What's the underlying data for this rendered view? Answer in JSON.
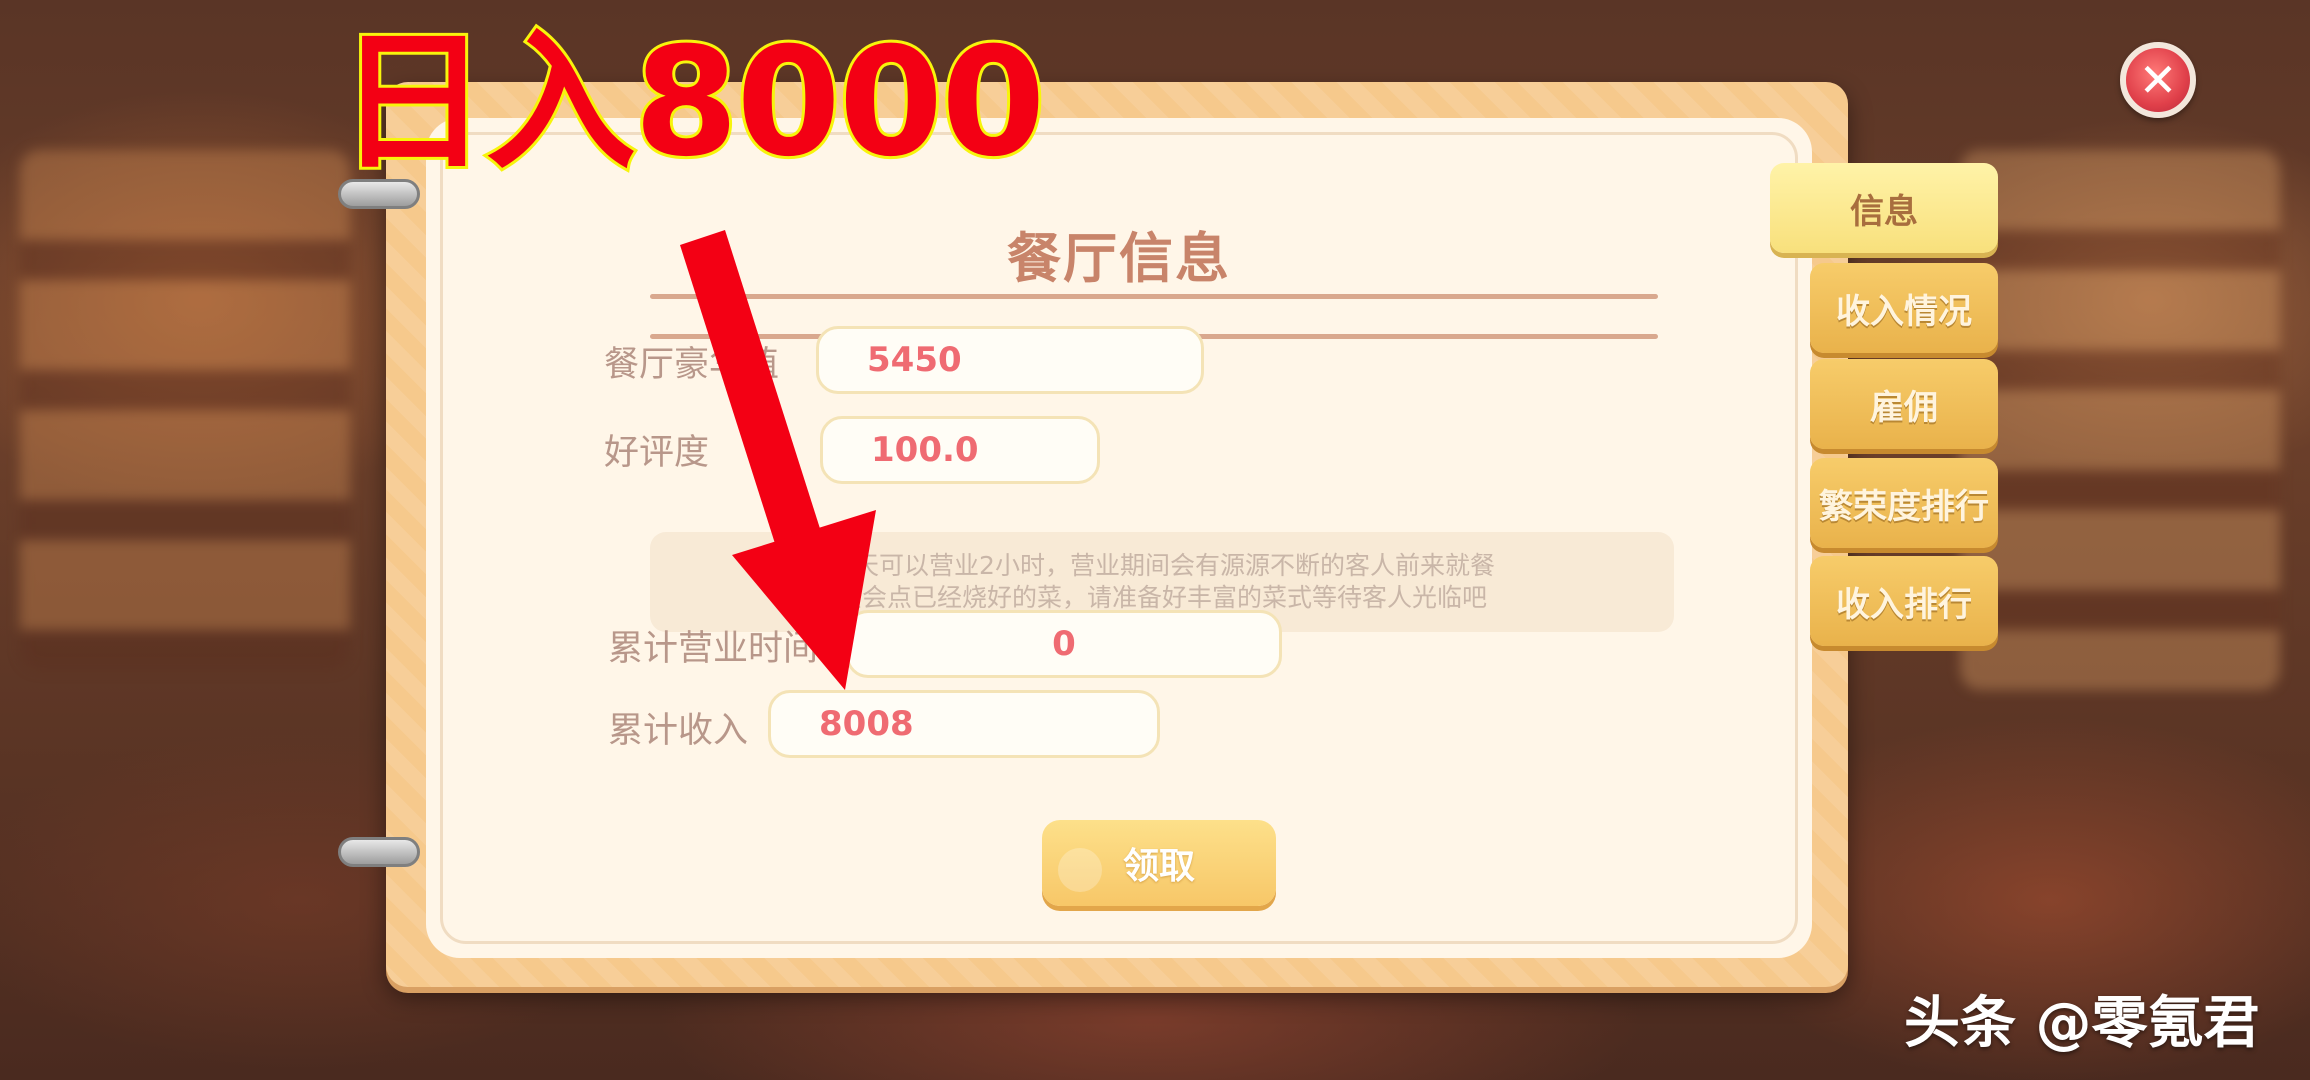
{
  "annotation": {
    "text": "日入8000"
  },
  "panel": {
    "title": "餐厅信息",
    "fields": {
      "luxury_label": "餐厅豪华值",
      "luxury_value": "5450",
      "rating_label": "好评度",
      "rating_value": "100.0",
      "hours_label": "累计营业时间",
      "hours_value": "0",
      "income_label": "累计收入",
      "income_value": "8008"
    },
    "notice": {
      "line1": "每天可以营业2小时，营业期间会有源源不断的客人前来就餐",
      "line2": "只会点已经烧好的菜，请准备好丰富的菜式等待客人光临吧"
    },
    "claim_button": "领取"
  },
  "tabs": [
    {
      "label": "信息",
      "active": true
    },
    {
      "label": "收入情况",
      "active": false
    },
    {
      "label": "雇佣",
      "active": false
    },
    {
      "label": "繁荣度排行",
      "active": false
    },
    {
      "label": "收入排行",
      "active": false
    }
  ],
  "close_icon": "close-icon",
  "watermark": "头条 @零氪君",
  "colors": {
    "annotation_text": "#f30014",
    "annotation_outline": "#f7f40c",
    "field_value": "#ef6b72",
    "tab": "#f0bd58"
  }
}
